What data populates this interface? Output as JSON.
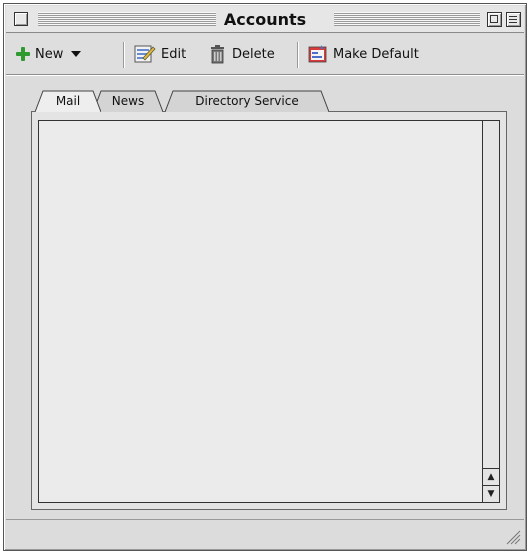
{
  "window": {
    "title": "Accounts"
  },
  "toolbar": {
    "new_label": "New",
    "edit_label": "Edit",
    "delete_label": "Delete",
    "make_default_label": "Make Default"
  },
  "tabs": [
    {
      "label": "Mail",
      "selected": true
    },
    {
      "label": "News",
      "selected": false
    },
    {
      "label": "Directory Service",
      "selected": false
    }
  ],
  "accounts_list": [],
  "icons": {
    "new": "plus-icon",
    "new_menu": "chevron-down-icon",
    "edit": "edit-icon",
    "delete": "trash-icon",
    "make_default": "make-default-icon"
  },
  "colors": {
    "plus_green": "#2f9a2f",
    "window_bg": "#dcdcdc"
  }
}
